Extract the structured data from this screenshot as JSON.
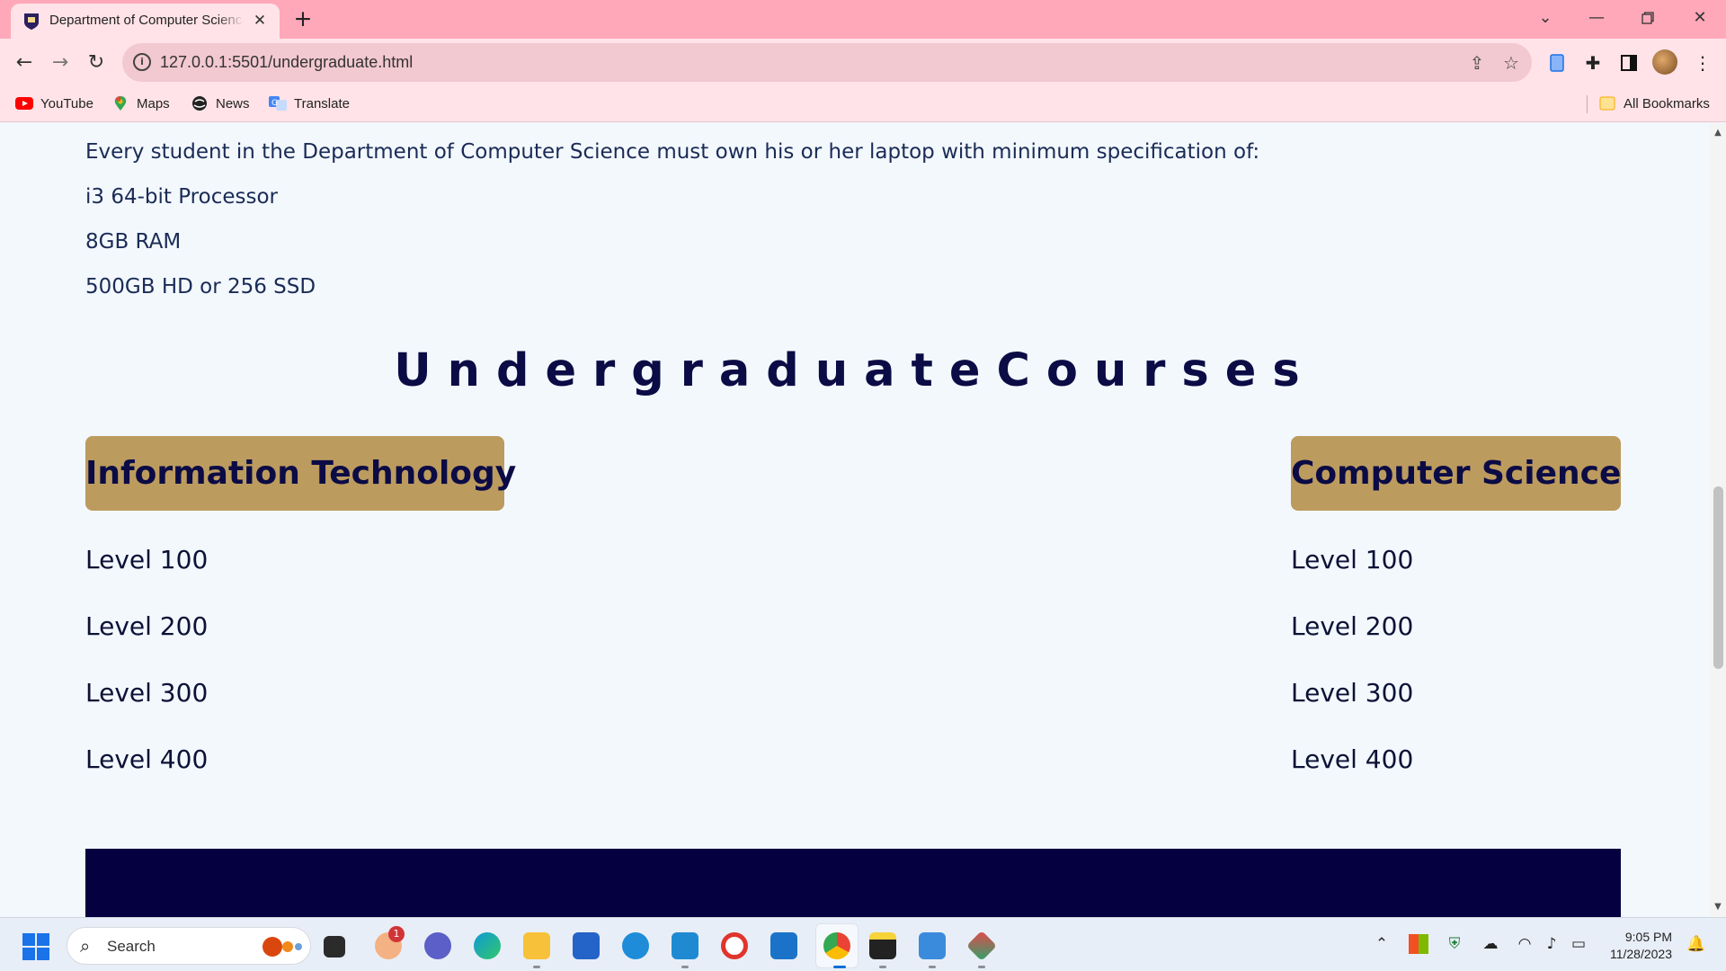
{
  "browser": {
    "tab_title": "Department of Computer Science",
    "url": "127.0.0.1:5501/undergraduate.html",
    "bookmarks": [
      {
        "label": "YouTube",
        "icon": "youtube-icon"
      },
      {
        "label": "Maps",
        "icon": "maps-icon"
      },
      {
        "label": "News",
        "icon": "news-icon"
      },
      {
        "label": "Translate",
        "icon": "translate-icon"
      }
    ],
    "all_bookmarks_label": "All Bookmarks"
  },
  "page": {
    "spec_intro": "Every student in the Department of Computer Science must own his or her laptop with minimum specification of:",
    "specs": [
      "i3 64-bit Processor",
      "8GB RAM",
      "500GB HD or 256 SSD"
    ],
    "section_title": "UndergraduateCourses",
    "programs": [
      {
        "name": "Information Technology",
        "levels": [
          "Level 100",
          "Level 200",
          "Level 300",
          "Level 400"
        ]
      },
      {
        "name": "Computer Science",
        "levels": [
          "Level 100",
          "Level 200",
          "Level 300",
          "Level 400"
        ]
      }
    ]
  },
  "taskbar": {
    "search_label": "Search",
    "badge_count": "1",
    "time": "9:05 PM",
    "date": "11/28/2023"
  },
  "colors": {
    "tab_strip": "#ffa8b9",
    "toolbar": "#ffe3e8",
    "page_bg": "#f3f8fd",
    "course_box": "#bc9b5f",
    "heading_navy": "#0b0b45",
    "footer_band": "#05003f"
  }
}
